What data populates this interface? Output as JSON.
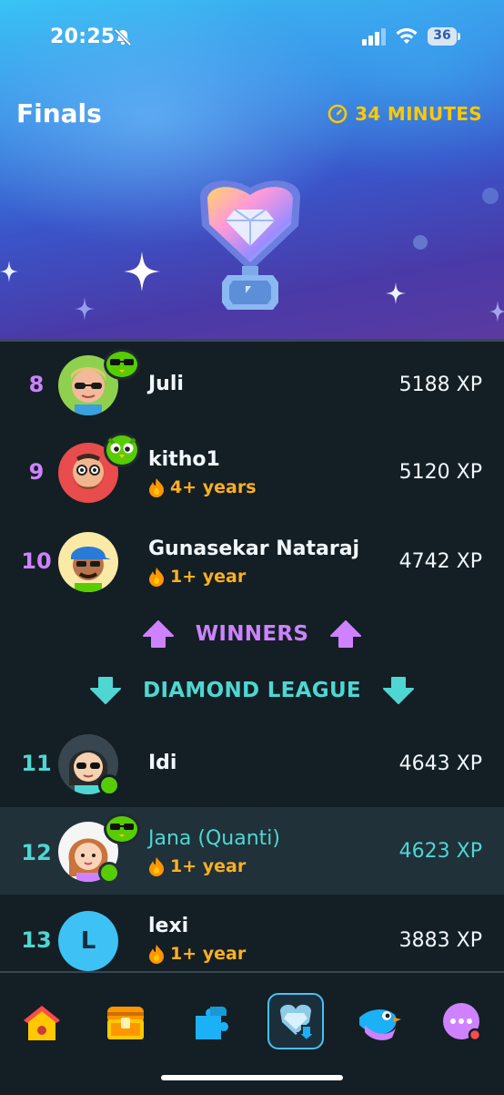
{
  "status_bar": {
    "time": "20:25",
    "battery": "36"
  },
  "header": {
    "title": "Finals",
    "timer": "34 MINUTES"
  },
  "colors": {
    "promote": "#ce82ff",
    "demote": "#4fd6d2",
    "streak": "#ffb020",
    "timer": "#ffc800",
    "accent_border": "#49c0f8"
  },
  "leaderboard": {
    "rows": [
      {
        "rank": "8",
        "name": "Juli",
        "streak": "",
        "xp": "5188 XP",
        "avatar_initial": ""
      },
      {
        "rank": "9",
        "name": "kitho1",
        "streak": "4+ years",
        "xp": "5120 XP",
        "avatar_initial": ""
      },
      {
        "rank": "10",
        "name": "Gunasekar Nataraj",
        "streak": "1+ year",
        "xp": "4742 XP",
        "avatar_initial": ""
      },
      {
        "rank": "11",
        "name": "Idi",
        "streak": "",
        "xp": "4643 XP",
        "avatar_initial": ""
      },
      {
        "rank": "12",
        "name": "Jana (Quanti)",
        "streak": "1+ year",
        "xp": "4623 XP",
        "avatar_initial": ""
      },
      {
        "rank": "13",
        "name": "lexi",
        "streak": "1+ year",
        "xp": "3883 XP",
        "avatar_initial": "L"
      }
    ],
    "promotion_zone_label": "WINNERS",
    "demotion_zone_label": "DIAMOND LEAGUE"
  },
  "nav": {
    "items": [
      {
        "icon": "home-icon"
      },
      {
        "icon": "treasure-chest-icon"
      },
      {
        "icon": "puzzle-icon"
      },
      {
        "icon": "leaderboard-icon",
        "active": true
      },
      {
        "icon": "bird-icon"
      },
      {
        "icon": "more-icon"
      }
    ]
  }
}
